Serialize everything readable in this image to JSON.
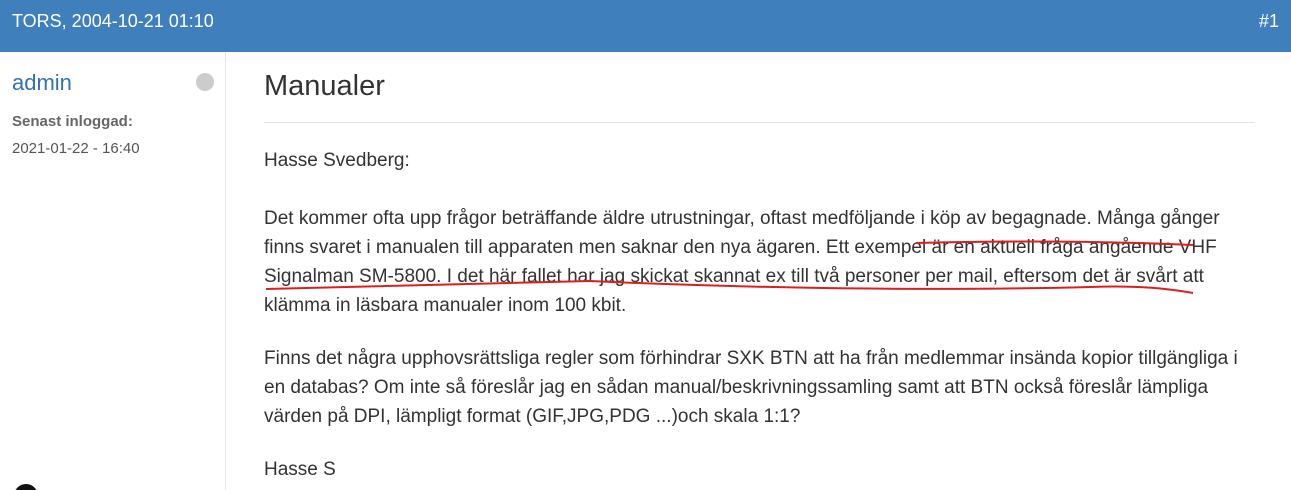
{
  "header": {
    "date": "TORS, 2004-10-21 01:10",
    "post_number": "#1"
  },
  "author": {
    "username": "admin",
    "last_login_label": "Senast inloggad:",
    "last_login_value": "2021-01-22 - 16:40",
    "status": "offline"
  },
  "post": {
    "title": "Manualer",
    "greeting": "Hasse Svedberg:",
    "paragraph1": "Det kommer ofta upp frågor beträffande äldre utrustningar, oftast medföljande i köp av begagnade. Många gånger finns svaret i manualen till apparaten men saknar den nya ägaren. Ett exempel är en aktuell fråga angående VHF Signalman SM-5800. I det här fallet har jag skickat skannat ex till två personer per mail, eftersom det är svårt att klämma in läsbara manualer inom 100 kbit.",
    "paragraph2": "Finns det några upphovsrättsliga regler som förhindrar SXK BTN att ha från medlemmar insända kopior tillgängliga i en databas? Om inte så föreslår jag en sådan manual/beskrivningssamling samt att BTN också föreslår lämpliga värden på DPI, lämpligt format (GIF,JPG,PDG ...)och skala 1:1?",
    "signature": "Hasse S"
  },
  "colors": {
    "header_bg": "#3f7fbc",
    "username": "#2f74b5",
    "annotation": "#d9201f",
    "status_dot": "#cccccc"
  }
}
